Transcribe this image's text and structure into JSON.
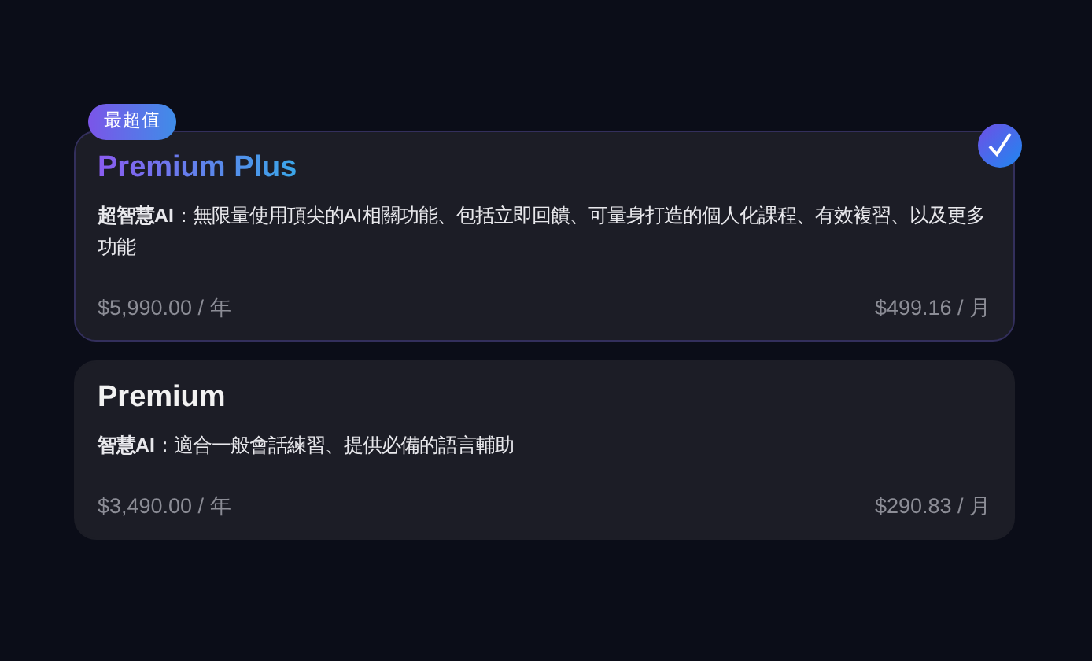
{
  "plans": [
    {
      "name": "Premium Plus",
      "badge": "最超值",
      "selected": true,
      "description": "**超智慧AI**：無限量使用頂尖的AI相關功能、包括立即回饋、可量身打造的個人化課程、有效複習、以及更多功能",
      "yearly_price": "$5,990.00 / 年",
      "monthly_price": "$499.16 / 月"
    },
    {
      "name": "Premium",
      "selected": false,
      "description": "**智慧AI**：適合一般會話練習、提供必備的語言輔助",
      "yearly_price": "$3,490.00 / 年",
      "monthly_price": "$290.83 / 月"
    }
  ]
}
